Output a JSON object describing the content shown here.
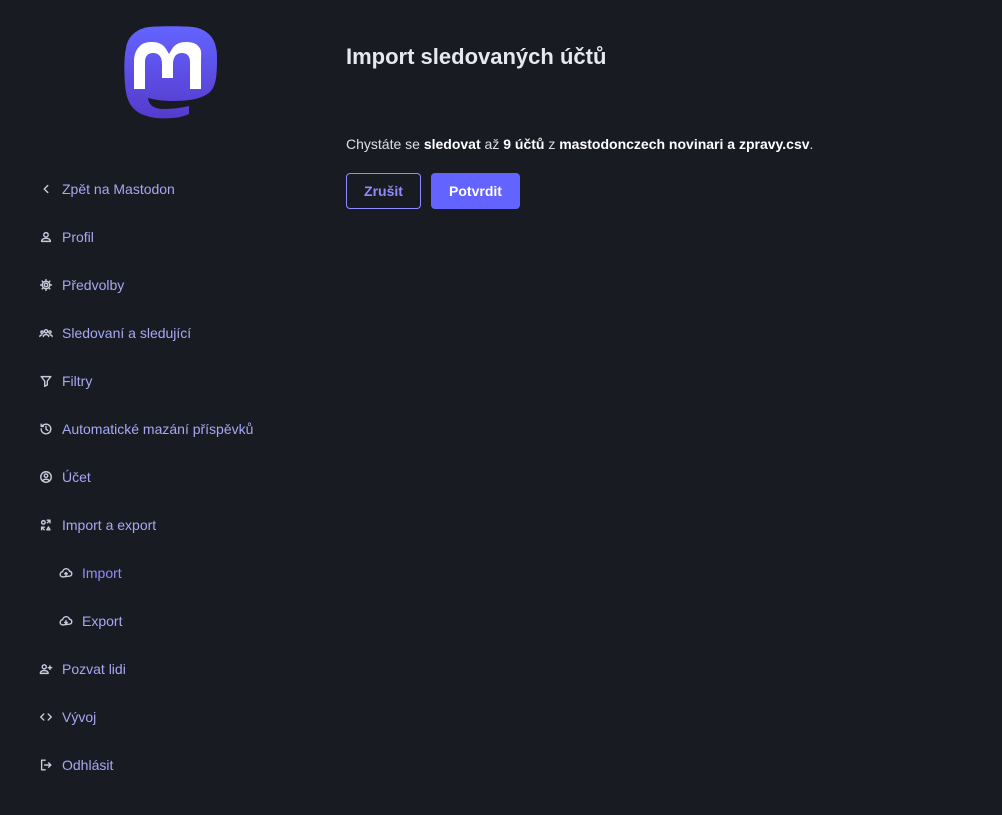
{
  "sidebar": {
    "logo_name": "mastodon-logo",
    "items": [
      {
        "label": "Zpět na Mastodon",
        "icon": "chevron-left-icon"
      },
      {
        "label": "Profil",
        "icon": "person-icon"
      },
      {
        "label": "Předvolby",
        "icon": "gear-icon"
      },
      {
        "label": "Sledovaní a sledující",
        "icon": "group-icon"
      },
      {
        "label": "Filtry",
        "icon": "filter-icon"
      },
      {
        "label": "Automatické mazání příspěvků",
        "icon": "history-icon"
      },
      {
        "label": "Účet",
        "icon": "account-circle-icon"
      },
      {
        "label": "Import a export",
        "icon": "sync-icon"
      },
      {
        "label": "Import",
        "icon": "cloud-upload-icon",
        "active": true
      },
      {
        "label": "Export",
        "icon": "cloud-download-icon"
      },
      {
        "label": "Pozvat lidi",
        "icon": "person-add-icon"
      },
      {
        "label": "Vývoj",
        "icon": "code-icon"
      },
      {
        "label": "Odhlásit",
        "icon": "logout-icon"
      }
    ]
  },
  "main": {
    "title": "Import sledovaných účtů",
    "message": {
      "part1": "Chystáte se ",
      "action": "sledovat",
      "part2": " až ",
      "count": "9 účtů",
      "part3": " z ",
      "filename": "mastodonczech novinari a zpravy.csv",
      "part4": "."
    },
    "buttons": {
      "cancel": "Zrušit",
      "confirm": "Potvrdit"
    }
  },
  "colors": {
    "background": "#191b22",
    "accent": "#6364ff",
    "link": "#8c8dff"
  }
}
